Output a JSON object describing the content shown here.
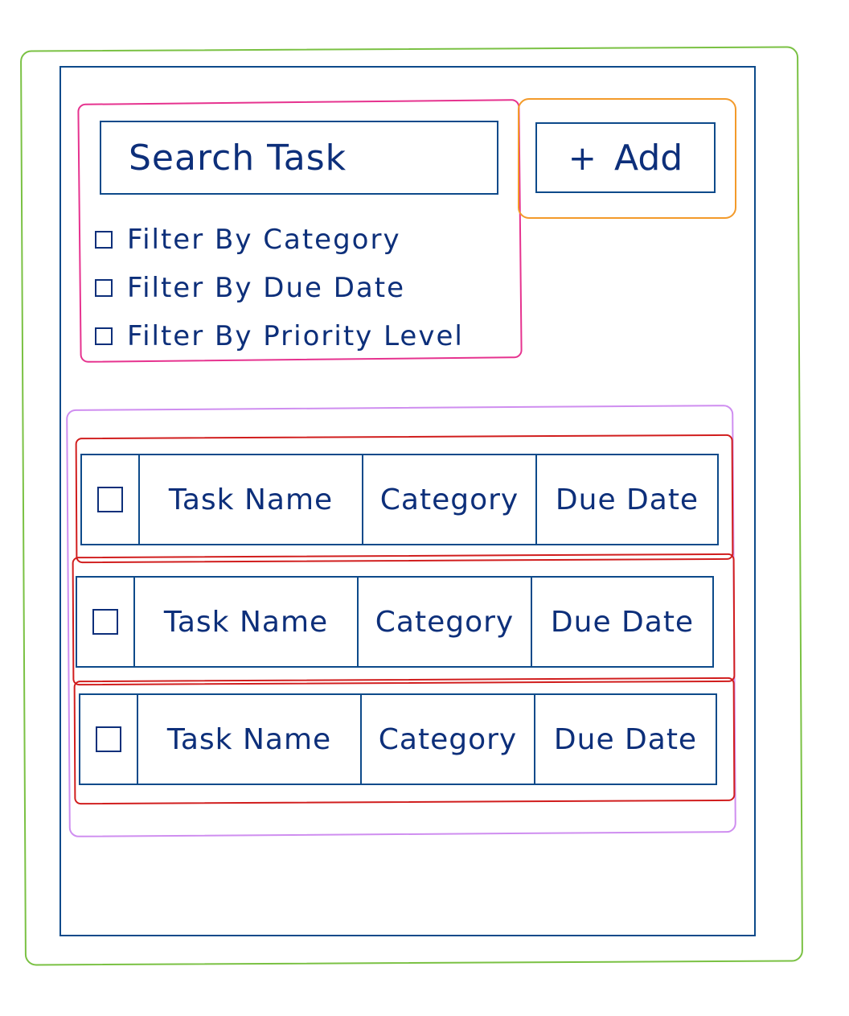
{
  "search": {
    "placeholder": "Search Task"
  },
  "add_button": {
    "icon": "plus-icon",
    "label": "Add"
  },
  "filters": [
    {
      "label": "Filter By Category",
      "checked": false
    },
    {
      "label": "Filter By Due Date",
      "checked": false
    },
    {
      "label": "Filter By Priority Level",
      "checked": false
    }
  ],
  "tasks": [
    {
      "name": "Task Name",
      "category": "Category",
      "due_date": "Due Date",
      "checked": false
    },
    {
      "name": "Task Name",
      "category": "Category",
      "due_date": "Due Date",
      "checked": false
    },
    {
      "name": "Task Name",
      "category": "Category",
      "due_date": "Due Date",
      "checked": false
    }
  ],
  "annotation_colors": {
    "app_outline": "#7ac143",
    "search_group_outline": "#e6338f",
    "add_group_outline": "#f39a2a",
    "list_outline": "#cf8ef0",
    "row_outline": "#d11e1e",
    "ink": "#0d2f7a"
  }
}
